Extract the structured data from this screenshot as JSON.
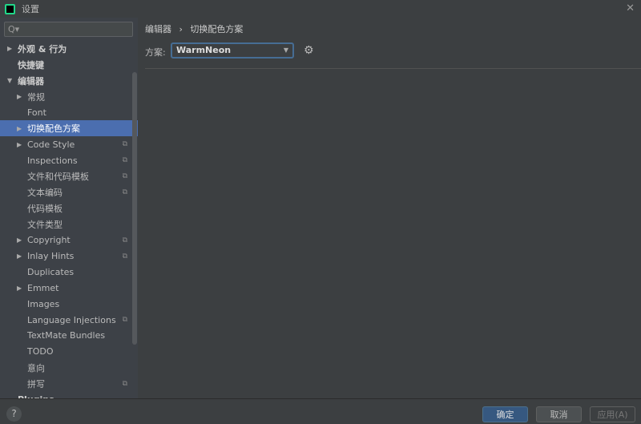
{
  "window": {
    "title": "设置",
    "close_icon": "close-icon"
  },
  "search": {
    "placeholder": "Q▾"
  },
  "tree": [
    {
      "label": "外观 & 行为",
      "level": 0,
      "arrow": "▶",
      "bold": true
    },
    {
      "label": "快捷键",
      "level": 0,
      "arrow": "",
      "bold": true
    },
    {
      "label": "编辑器",
      "level": 0,
      "arrow": "▼",
      "bold": true
    },
    {
      "label": "常规",
      "level": 1,
      "arrow": "▶"
    },
    {
      "label": "Font",
      "level": 1,
      "arrow": ""
    },
    {
      "label": "切换配色方案",
      "level": 1,
      "arrow": "▶",
      "selected": true
    },
    {
      "label": "Code Style",
      "level": 1,
      "arrow": "▶",
      "copy": true
    },
    {
      "label": "Inspections",
      "level": 1,
      "arrow": "",
      "copy": true
    },
    {
      "label": "文件和代码模板",
      "level": 1,
      "arrow": "",
      "copy": true
    },
    {
      "label": "文本编码",
      "level": 1,
      "arrow": "",
      "copy": true
    },
    {
      "label": "代码模板",
      "level": 1,
      "arrow": ""
    },
    {
      "label": "文件类型",
      "level": 1,
      "arrow": ""
    },
    {
      "label": "Copyright",
      "level": 1,
      "arrow": "▶",
      "copy": true
    },
    {
      "label": "Inlay Hints",
      "level": 1,
      "arrow": "▶",
      "copy": true
    },
    {
      "label": "Duplicates",
      "level": 1,
      "arrow": ""
    },
    {
      "label": "Emmet",
      "level": 1,
      "arrow": "▶"
    },
    {
      "label": "Images",
      "level": 1,
      "arrow": ""
    },
    {
      "label": "Language Injections",
      "level": 1,
      "arrow": "",
      "copy": true
    },
    {
      "label": "TextMate Bundles",
      "level": 1,
      "arrow": ""
    },
    {
      "label": "TODO",
      "level": 1,
      "arrow": ""
    },
    {
      "label": "意向",
      "level": 1,
      "arrow": ""
    },
    {
      "label": "拼写",
      "level": 1,
      "arrow": "",
      "copy": true
    },
    {
      "label": "Plugins",
      "level": 0,
      "arrow": "",
      "bold": true
    }
  ],
  "breadcrumb": {
    "parent": "编辑器",
    "sep": "›",
    "current": "切换配色方案"
  },
  "scheme": {
    "label": "方案:",
    "value": "WarmNeon"
  },
  "footer": {
    "help": "?",
    "ok": "确定",
    "cancel": "取消",
    "apply": "应用(A)"
  },
  "colors": {
    "selection": "#4b6eaf",
    "ok_button": "#365880"
  }
}
